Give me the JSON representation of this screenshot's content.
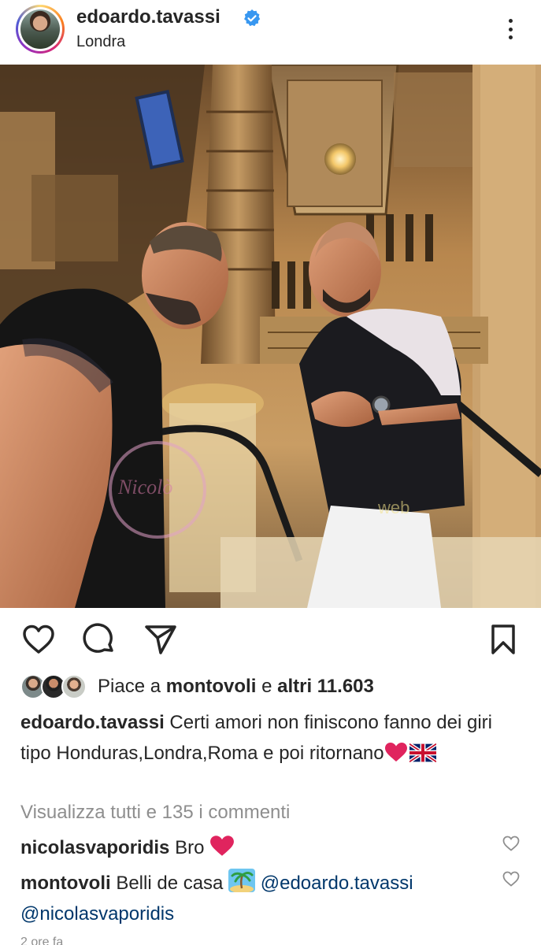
{
  "header": {
    "username": "edoardo.tavassi",
    "location": "Londra"
  },
  "photo": {
    "watermark_left": "Nicolò",
    "watermark_right": "web"
  },
  "likes": {
    "prefix": "Piace a",
    "liker": "montovoli",
    "conjunction": "e",
    "others": "altri 11.603"
  },
  "caption": {
    "username": "edoardo.tavassi",
    "text": "Certi amori non finiscono fanno dei giri tipo Honduras,Londra,Roma e poi ritornano"
  },
  "view_all_comments": "Visualizza tutti e 135 i commenti",
  "comments": [
    {
      "username": "nicolasvaporidis",
      "text": "Bro"
    },
    {
      "username": "montovoli",
      "text": "Belli de casa",
      "mention1": "@edoardo.tavassi",
      "mention2": "@nicolasvaporidis"
    }
  ],
  "timestamp": "2 ore fa",
  "icons": {
    "verified": "verified-badge-icon",
    "more": "more-options-icon",
    "like": "heart-icon",
    "comment": "comment-icon",
    "share": "paper-plane-icon",
    "save": "bookmark-icon"
  },
  "colors": {
    "text": "#262626",
    "secondary": "#8e8e8e",
    "verified": "#3897f0",
    "mention": "#00376b",
    "heart_emoji": "#e0245e"
  }
}
